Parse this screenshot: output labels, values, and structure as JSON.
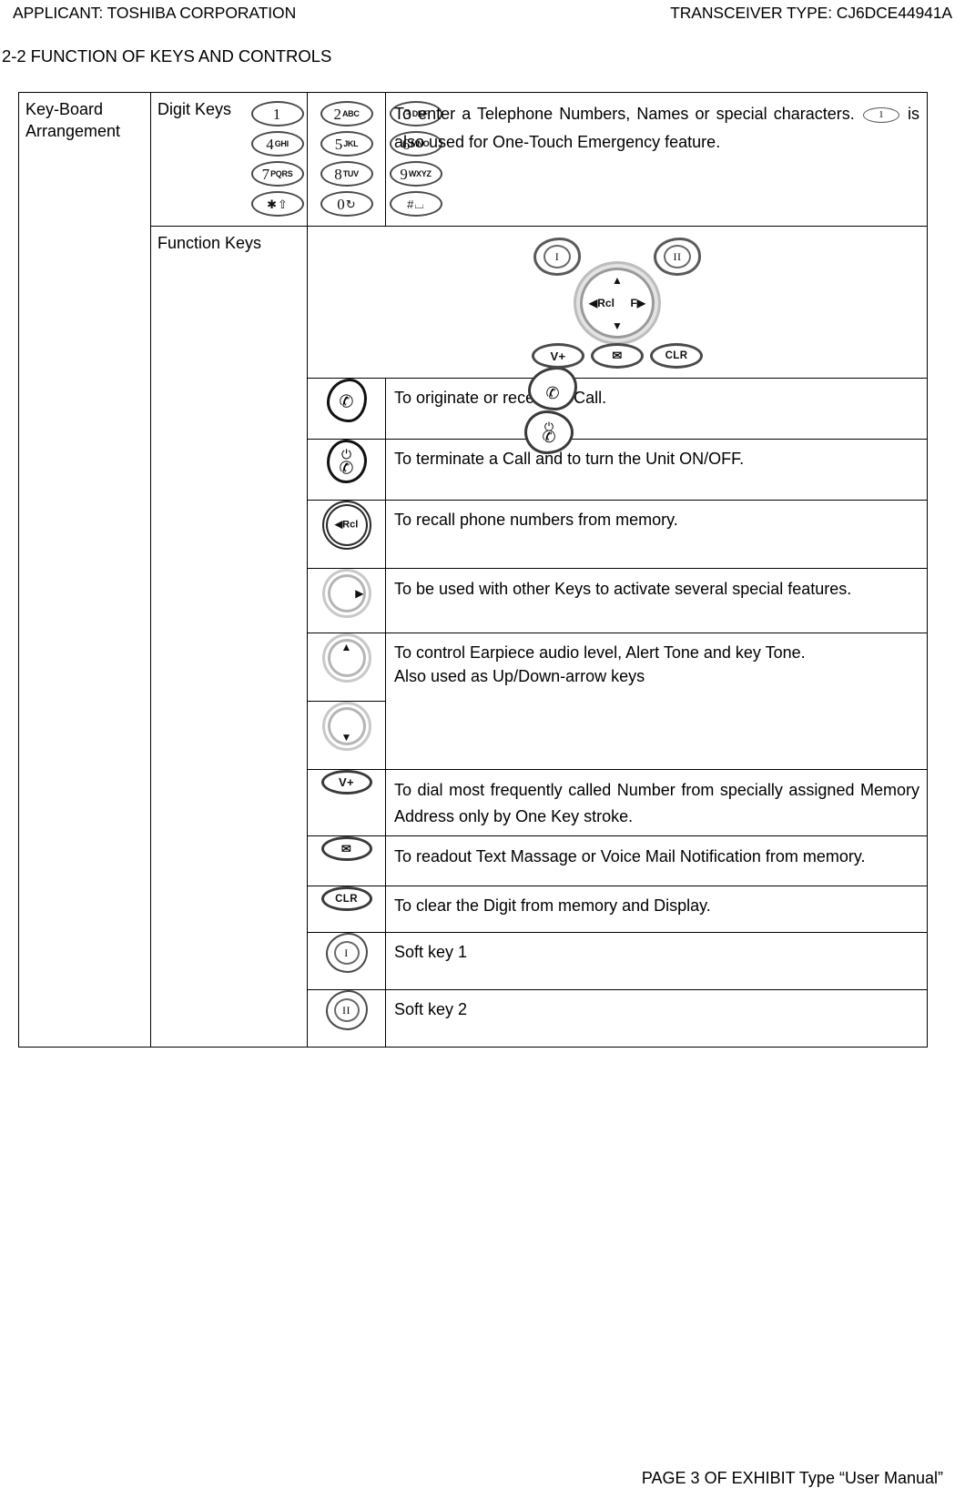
{
  "header": {
    "applicant": "APPLICANT: TOSHIBA CORPORATION",
    "transceiver": "TRANSCEIVER TYPE: CJ6DCE44941A"
  },
  "section": {
    "title": "2-2 FUNCTION OF KEYS AND CONTROLS"
  },
  "table": {
    "category": "Key-Board Arrangement",
    "groups": {
      "digit_keys": "Digit Keys",
      "function_keys": "Function Keys"
    },
    "digit_keys_description": {
      "part1": "To enter a Telephone Numbers, Names or special characters.",
      "inline_key": "1",
      "part2": "is also used for One-Touch Emergency feature."
    },
    "keypad": [
      [
        {
          "num": "1",
          "sub": ""
        },
        {
          "num": "2",
          "sub": "ABC"
        },
        {
          "num": "3",
          "sub": "DEF"
        }
      ],
      [
        {
          "num": "4",
          "sub": "GHI"
        },
        {
          "num": "5",
          "sub": "JKL"
        },
        {
          "num": "6",
          "sub": "MNO"
        }
      ],
      [
        {
          "num": "7",
          "sub": "PQRS"
        },
        {
          "num": "8",
          "sub": "TUV"
        },
        {
          "num": "9",
          "sub": "WXYZ"
        }
      ],
      [
        {
          "num": "✱",
          "sub": "⇧"
        },
        {
          "num": "0",
          "sub": "↻"
        },
        {
          "num": "#",
          "sub": "⌴"
        }
      ]
    ],
    "cluster": {
      "soft_key_1": "I",
      "soft_key_2": "II",
      "nav_left": "◀Rcl",
      "nav_right": "F▶",
      "nav_up": "▲",
      "nav_down": "▼",
      "send": "✆",
      "end_power": "⏻",
      "end_handset": "✆",
      "volume": "V+",
      "mail": "✉",
      "clear": "CLR"
    },
    "rows": [
      {
        "icon_label": "",
        "desc": "To originate or receive a Call."
      },
      {
        "icon_label": "",
        "desc": "To terminate a Call and to turn the Unit ON/OFF."
      },
      {
        "icon_label": "Rcl",
        "desc": "To recall phone numbers from memory."
      },
      {
        "icon_label": "",
        "desc": "To be used with other Keys to activate several special features."
      },
      {
        "icon_label": "",
        "desc_line1": "To control Earpiece audio level, Alert Tone and key Tone.",
        "desc_line2": "Also used as Up/Down-arrow keys"
      },
      {
        "icon_label": "V+",
        "desc": "To dial most frequently called Number from specially assigned Memory Address only by One Key stroke."
      },
      {
        "icon_label": "✉",
        "desc": "To readout Text Massage or Voice Mail Notification from memory."
      },
      {
        "icon_label": "CLR",
        "desc": "To clear the Digit from memory and Display."
      },
      {
        "icon_label": "I",
        "desc": "Soft key 1"
      },
      {
        "icon_label": "II",
        "desc": "Soft key 2"
      }
    ]
  },
  "footer": {
    "text": "PAGE 3 OF EXHIBIT Type “User Manual”"
  }
}
